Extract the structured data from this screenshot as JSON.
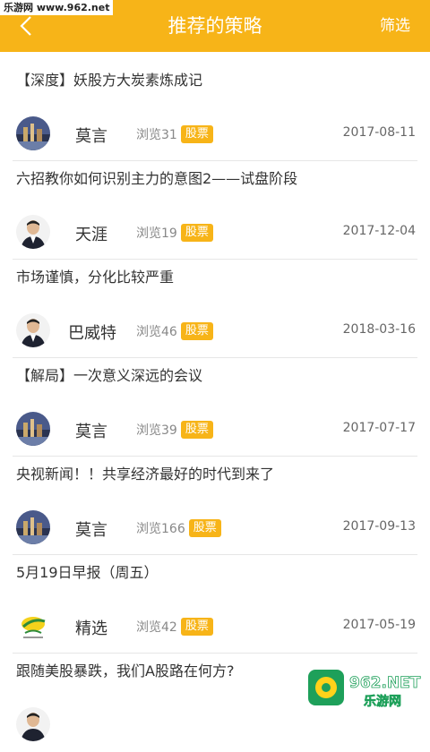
{
  "watermark_top": "乐游网 www.962.net",
  "header": {
    "title": "推荐的策略",
    "filter_label": "筛选"
  },
  "colors": {
    "accent": "#f7b418"
  },
  "items": [
    {
      "title": "【深度】妖股方大炭素炼成记",
      "author": "莫言",
      "views": "浏览31",
      "badge": "股票",
      "date": "2017-08-11",
      "avatar": "city-avatar"
    },
    {
      "title": "六招教你如何识别主力的意图2——试盘阶段",
      "author": "天涯",
      "views": "浏览19",
      "badge": "股票",
      "date": "2017-12-04",
      "avatar": "man-avatar"
    },
    {
      "title": "市场谨慎，分化比较严重",
      "author": "巴威特",
      "views": "浏览46",
      "badge": "股票",
      "date": "2018-03-16",
      "avatar": "man-avatar"
    },
    {
      "title": "【解局】一次意义深远的会议",
      "author": "莫言",
      "views": "浏览39",
      "badge": "股票",
      "date": "2017-07-17",
      "avatar": "city-avatar"
    },
    {
      "title": "央视新闻！！共享经济最好的时代到来了",
      "author": "莫言",
      "views": "浏览166",
      "badge": "股票",
      "date": "2017-09-13",
      "avatar": "city-avatar"
    },
    {
      "title": "5月19日早报（周五）",
      "author": "精选",
      "views": "浏览42",
      "badge": "股票",
      "date": "2017-05-19",
      "avatar": "logo-avatar"
    },
    {
      "title": "跟随美股暴跌，我们A股路在何方?",
      "author": "",
      "views": "",
      "badge": "",
      "date": "",
      "avatar": "man-avatar"
    }
  ],
  "watermark_bottom": {
    "top": "962.NET",
    "bottom": "乐游网"
  }
}
